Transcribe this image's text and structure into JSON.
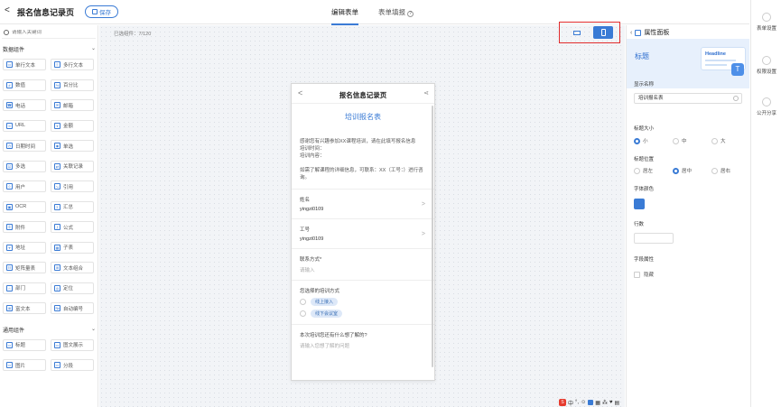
{
  "header": {
    "back": "<",
    "title": "报名信息记录页",
    "save_label": "保存",
    "tabs": [
      {
        "label": "编辑表单",
        "active": true
      },
      {
        "label": "表单填报",
        "active": false
      }
    ],
    "tab_help": "?"
  },
  "sidebar": {
    "search_placeholder": "请输入关键词",
    "sections": [
      {
        "title": "数据组件",
        "items": [
          "单行文本",
          "多行文本",
          "数值",
          "百分比",
          "电话",
          "邮箱",
          "URL",
          "金额",
          "日期时间",
          "单选",
          "多选",
          "关联记录",
          "用户",
          "引用",
          "OCR",
          "汇总",
          "附件",
          "公式",
          "地址",
          "子表",
          "矩阵量表",
          "文本组合",
          "部门",
          "定位",
          "富文本",
          "自动编号"
        ]
      },
      {
        "title": "通用组件",
        "items": [
          "标题",
          "图文展示",
          "图片",
          "分段"
        ]
      }
    ]
  },
  "canvas": {
    "selected_count": "已选组件：7/120",
    "device_options": [
      "desktop",
      "mobile"
    ],
    "active_device": "mobile"
  },
  "phone": {
    "back": "<",
    "title": "报名信息记录页",
    "share": "<",
    "form_title": "培训报名表",
    "intro": [
      "感谢您有兴趣参加XX课程培训，请在此填写报名信息",
      "培训时间：",
      "培训内容：",
      "如需了解课程的详细信息，可联系：XX（工号：）进行咨询。"
    ],
    "fields": [
      {
        "label": "姓名",
        "value": "yingzi0109",
        "arrow": ">"
      },
      {
        "label": "工号",
        "value": "yingzi0109",
        "arrow": ">"
      },
      {
        "label": "联系方式*",
        "placeholder": "请输入"
      },
      {
        "label": "您选择的培训方式",
        "options": [
          "线上接入",
          "线下会议室"
        ]
      },
      {
        "label": "本次培训您还有什么想了解的?",
        "placeholder": "请输入您想了解的问题"
      }
    ]
  },
  "panel": {
    "title": "属性面板",
    "banner_label": "标题",
    "banner_card": "Headline",
    "banner_t": "T",
    "display_name_label": "显示名称",
    "display_name_value": "培训报名表",
    "title_size_label": "标题大小",
    "title_size_options": [
      "小",
      "中",
      "大"
    ],
    "title_size_selected": "小",
    "title_pos_label": "标题位置",
    "title_pos_options": [
      "居左",
      "居中",
      "居右"
    ],
    "title_pos_selected": "居中",
    "font_color_label": "字体颜色",
    "font_color": "#3a7bd5",
    "rows_label": "行数",
    "field_attr_label": "字段属性",
    "hide_label": "隐藏"
  },
  "rail": {
    "items": [
      "表单设置",
      "权限设置",
      "公开分享"
    ]
  },
  "ime": {
    "items": [
      "中",
      "°,",
      "☺",
      "♦",
      "▦",
      "⁂",
      "♥",
      "▤"
    ]
  }
}
